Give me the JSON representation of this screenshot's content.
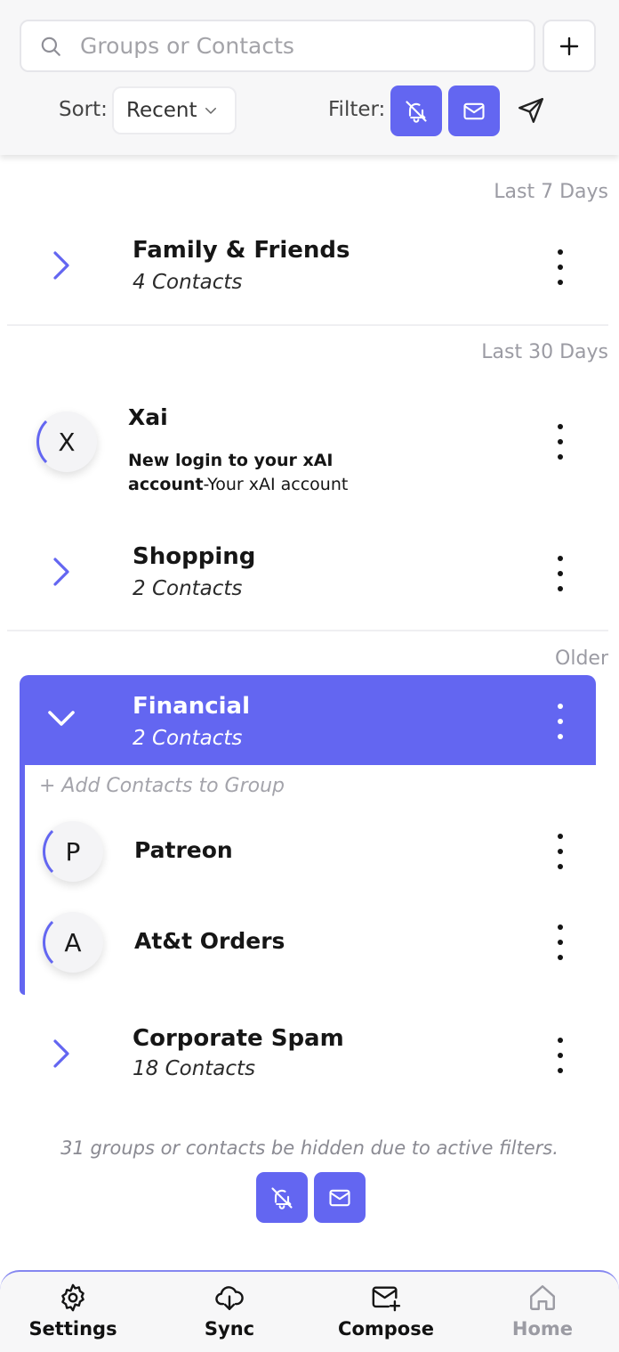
{
  "search": {
    "placeholder": "Groups or Contacts"
  },
  "sort": {
    "label": "Sort:",
    "value": "Recent"
  },
  "filter": {
    "label": "Filter:"
  },
  "sections": {
    "last7": "Last 7 Days",
    "last30": "Last 30 Days",
    "older": "Older"
  },
  "groups": {
    "family": {
      "title": "Family & Friends",
      "subtitle": "4 Contacts"
    },
    "shopping": {
      "title": "Shopping",
      "subtitle": "2 Contacts"
    },
    "financial": {
      "title": "Financial",
      "subtitle": "2 Contacts"
    },
    "corporate": {
      "title": "Corporate Spam",
      "subtitle": "18 Contacts"
    }
  },
  "xai": {
    "initial": "X",
    "name": "Xai",
    "message_bold": "New login to your xAI account",
    "message_rest": "-Your xAI account"
  },
  "financial_contacts": {
    "add_label": "+ Add Contacts to Group",
    "patreon": {
      "initial": "P",
      "name": "Patreon"
    },
    "att": {
      "initial": "A",
      "name": "At&t Orders"
    }
  },
  "hidden_note": "31 groups or contacts be hidden due to active filters.",
  "nav": {
    "settings": "Settings",
    "sync": "Sync",
    "compose": "Compose",
    "home": "Home"
  },
  "colors": {
    "accent": "#6366f1",
    "muted_text": "#9b9ba3"
  }
}
